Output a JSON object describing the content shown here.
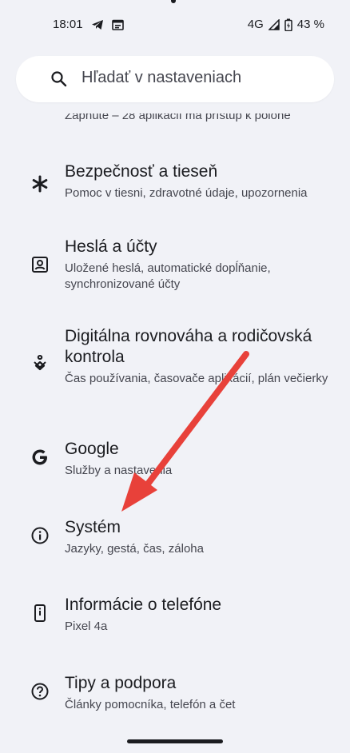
{
  "status_bar": {
    "time": "18:01",
    "network": "4G",
    "battery": "43 %",
    "icons": [
      "telegram-icon",
      "calendar-icon",
      "signal-icon",
      "battery-icon"
    ]
  },
  "search": {
    "placeholder": "Hľadať v nastaveniach",
    "icon": "search-icon"
  },
  "cut_item": {
    "subtitle": "Zapnuté – 28 aplikácií má prístup k polohe"
  },
  "items": [
    {
      "title": "Bezpečnosť a tieseň",
      "subtitle": "Pomoc v tiesni, zdravotné údaje, upozornenia",
      "icon": "asterisk-icon"
    },
    {
      "title": "Heslá a účty",
      "subtitle": "Uložené heslá, automatické dopĺňanie, synchronizované účty",
      "icon": "account-box-icon"
    },
    {
      "title": "Digitálna rovnováha a rodičovská kontrola",
      "subtitle": "Čas používania, časovače aplikácií, plán večierky",
      "icon": "digital-wellbeing-icon"
    },
    {
      "title": "Google",
      "subtitle": "Služby a nastavenia",
      "icon": "google-icon"
    },
    {
      "title": "Systém",
      "subtitle": "Jazyky, gestá, čas, záloha",
      "icon": "info-icon"
    },
    {
      "title": "Informácie o telefóne",
      "subtitle": "Pixel 4a",
      "icon": "phone-icon"
    },
    {
      "title": "Tipy a podpora",
      "subtitle": "Články pomocníka, telefón a čet",
      "icon": "help-icon"
    }
  ],
  "annotation": {
    "arrow_color": "#e8413a",
    "icon": "red-arrow-icon"
  }
}
